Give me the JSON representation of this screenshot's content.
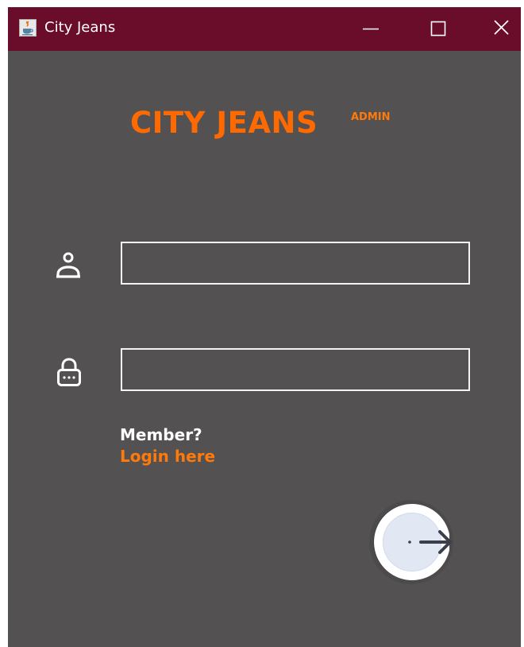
{
  "window": {
    "title": "City Jeans",
    "app_icon": "java-cup-icon",
    "controls": [
      "minimize-icon",
      "maximize-icon",
      "close-icon"
    ]
  },
  "brand": {
    "name": "CITY JEANS",
    "superscript": "ADMIN"
  },
  "form": {
    "username": {
      "icon": "user-icon",
      "value": ""
    },
    "password": {
      "icon": "lock-icon",
      "value": ""
    },
    "member_prompt": "Member?",
    "login_link": "Login here",
    "submit_icon": "login-arrow-icon"
  },
  "colors": {
    "titlebar": "#6a0d2b",
    "background": "#535152",
    "accent": "#ff6a00",
    "field_border": "#f3f3f3"
  }
}
